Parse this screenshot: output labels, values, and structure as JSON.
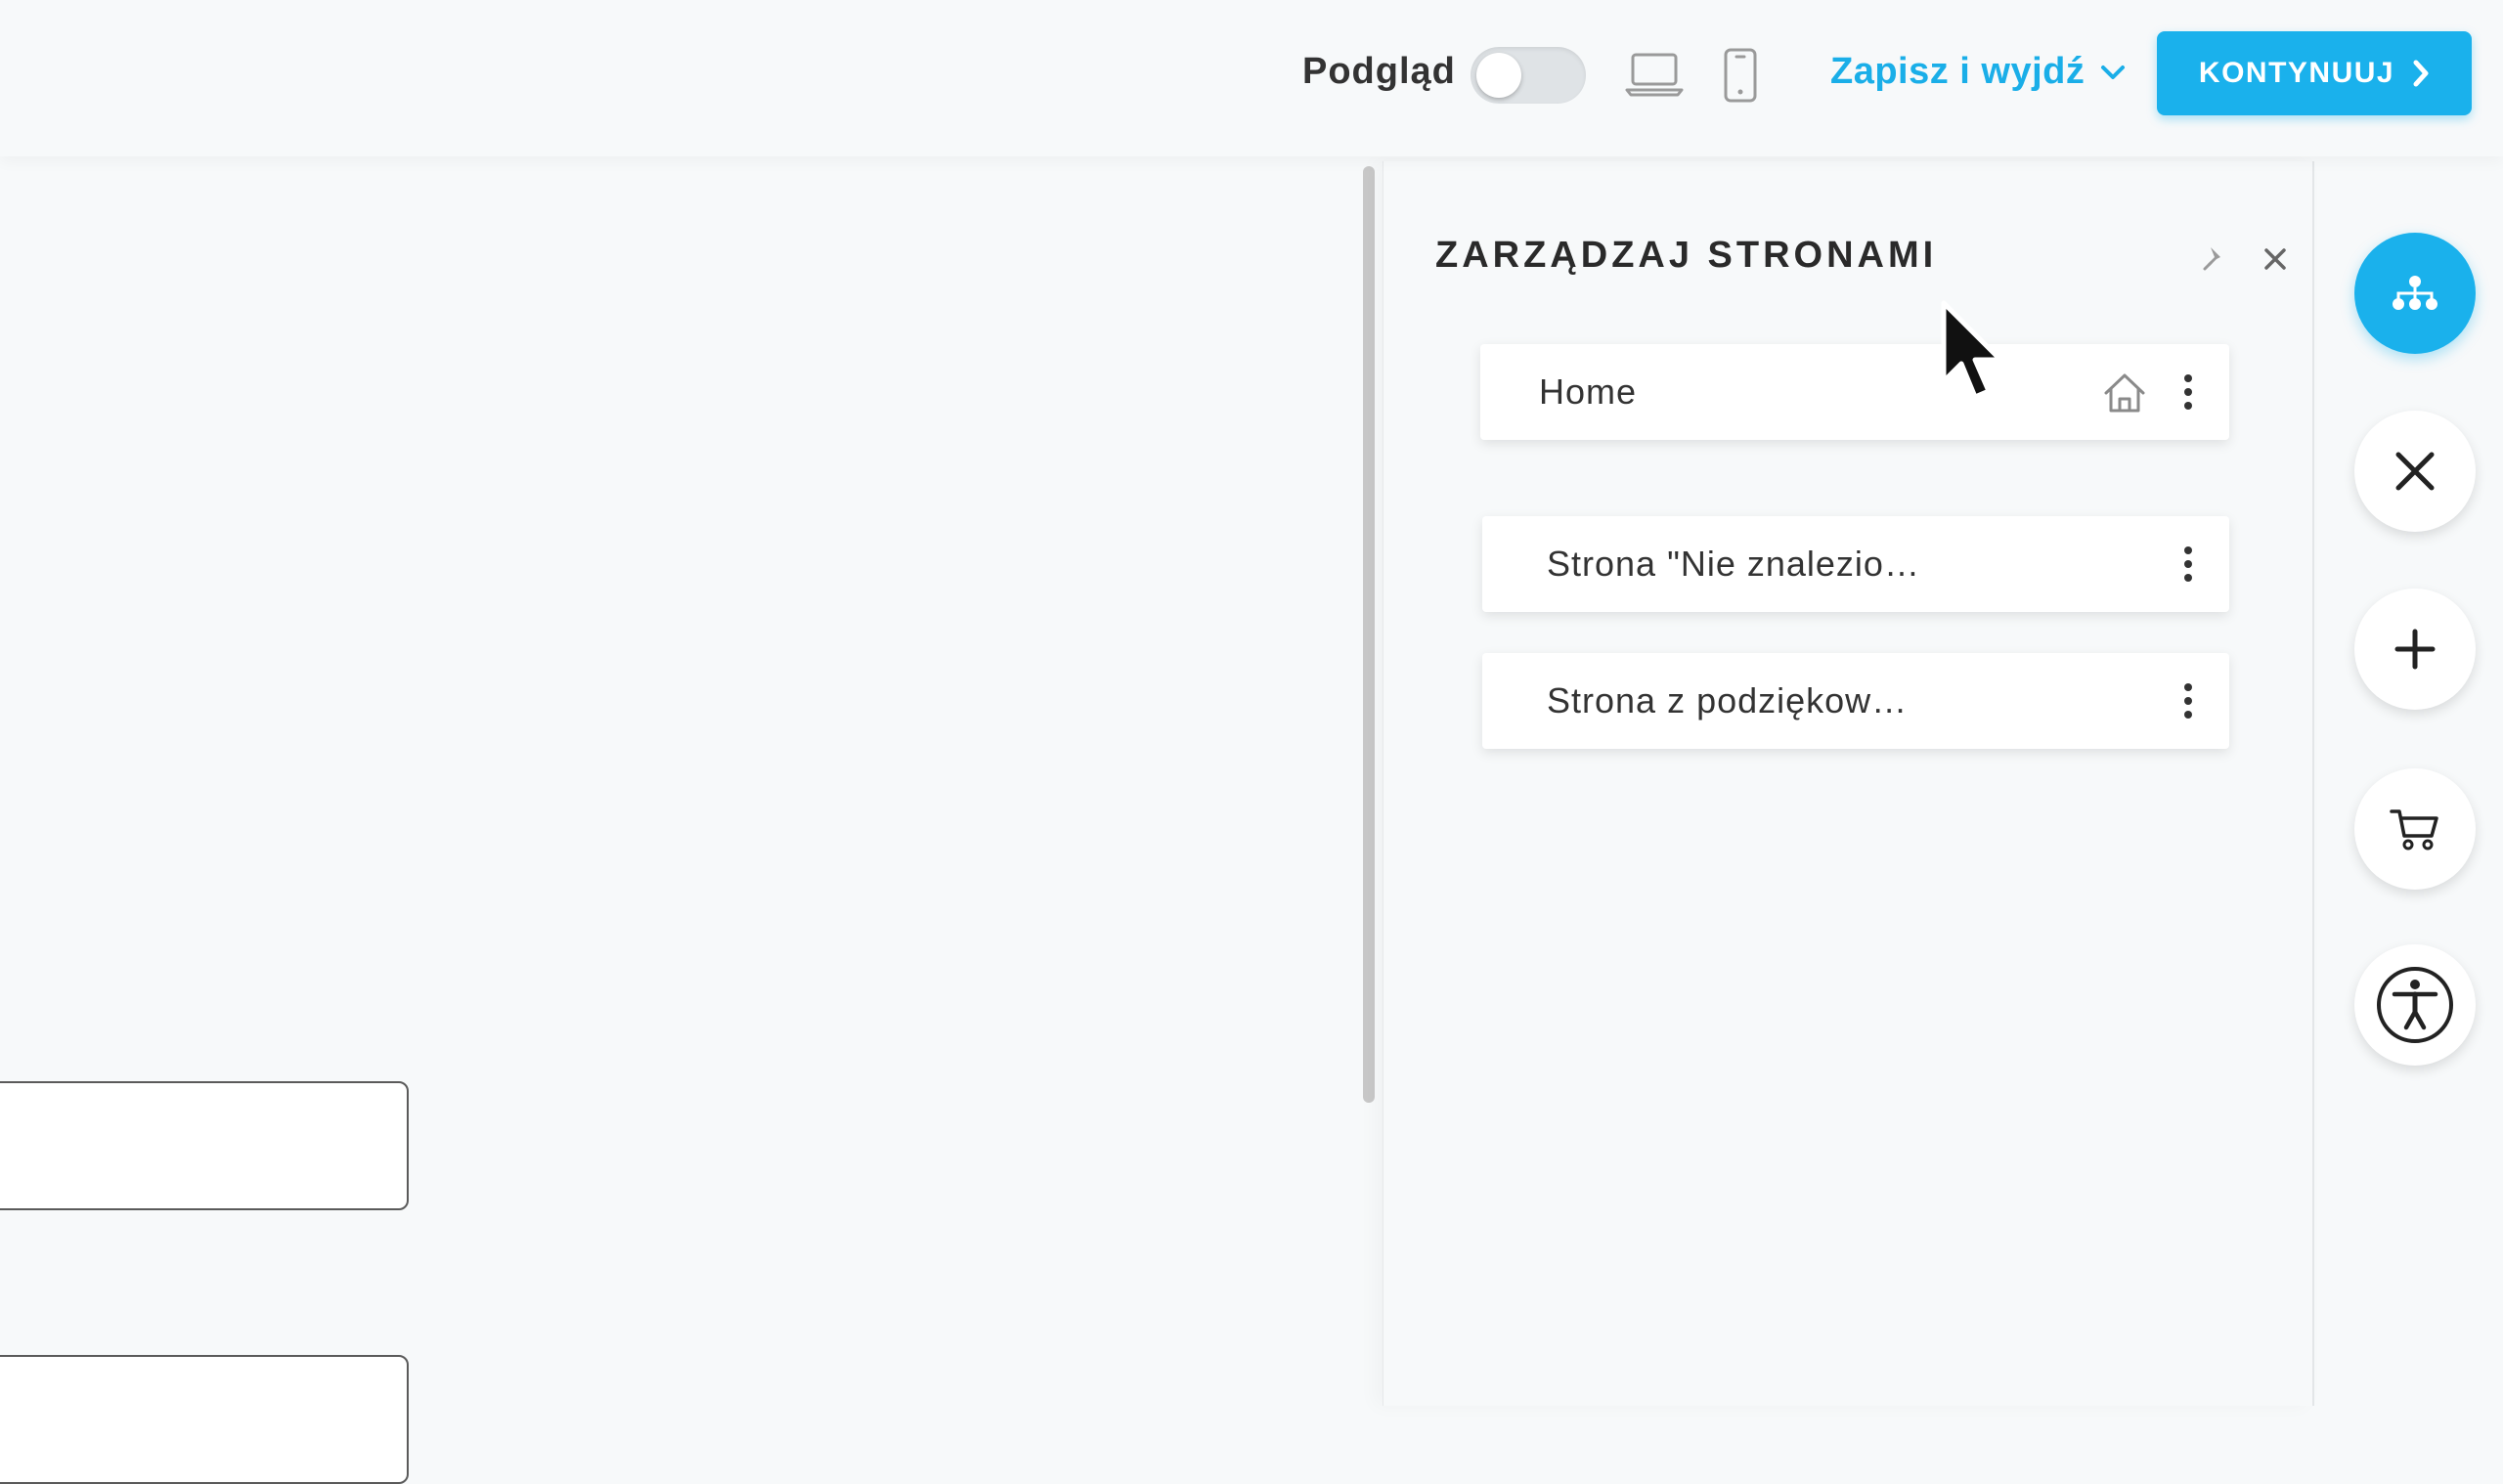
{
  "header": {
    "preview_label": "Podgląd",
    "preview_enabled": false,
    "save_exit_label": "Zapisz i wyjdź",
    "continue_label": "KONTYNUUJ",
    "icons": [
      "laptop-icon",
      "mobile-icon",
      "chevron-down-icon",
      "chevron-right-icon"
    ]
  },
  "pages_panel": {
    "title": "ZARZĄDZAJ STRONAMI",
    "icons": [
      "pin-icon",
      "close-icon"
    ],
    "pages": [
      {
        "label": "Home",
        "is_home": true,
        "icons": [
          "home-icon",
          "more-vertical-icon"
        ]
      },
      {
        "label": "Strona \"Nie znalezio…",
        "is_home": false,
        "icons": [
          "more-vertical-icon"
        ]
      },
      {
        "label": "Strona z podziękow…",
        "is_home": false,
        "icons": [
          "more-vertical-icon"
        ]
      }
    ]
  },
  "sidebar": {
    "buttons": [
      {
        "icon": "sitemap-icon",
        "active": true
      },
      {
        "icon": "tools-icon",
        "active": false
      },
      {
        "icon": "plus-icon",
        "active": false
      },
      {
        "icon": "cart-icon",
        "active": false
      },
      {
        "icon": "accessibility-icon",
        "active": false
      }
    ]
  },
  "colors": {
    "accent": "#1ab1ec",
    "background": "#f7f9fa",
    "card": "#ffffff",
    "text": "#333333"
  }
}
